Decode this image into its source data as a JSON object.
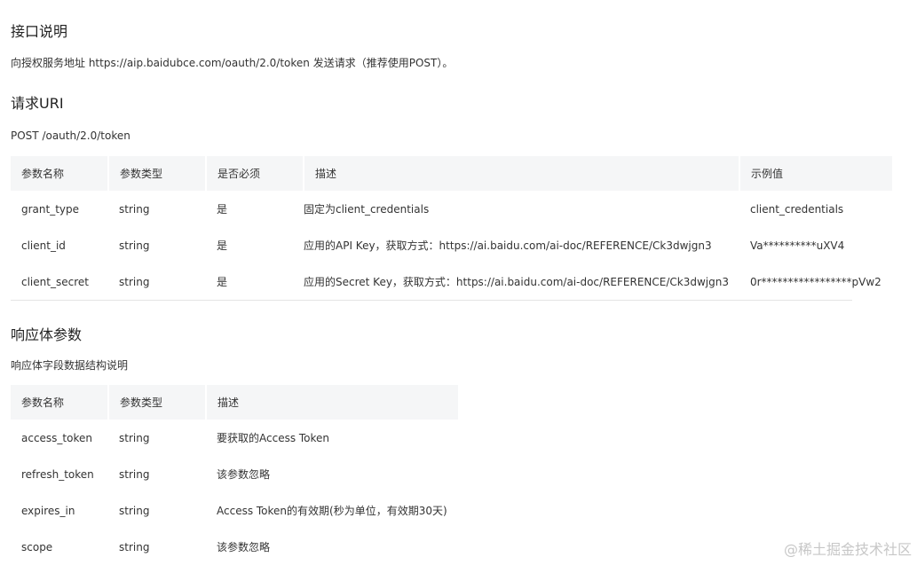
{
  "section1": {
    "title": "接口说明",
    "text": "向授权服务地址 https://aip.baidubce.com/oauth/2.0/token 发送请求（推荐使用POST）。"
  },
  "section2": {
    "title": "请求URI",
    "text": "POST /oauth/2.0/token",
    "headers": [
      "参数名称",
      "参数类型",
      "是否必须",
      "描述",
      "示例值"
    ],
    "rows": [
      [
        "grant_type",
        "string",
        "是",
        "固定为client_credentials",
        "client_credentials"
      ],
      [
        "client_id",
        "string",
        "是",
        "应用的API Key，获取方式：https://ai.baidu.com/ai-doc/REFERENCE/Ck3dwjgn3",
        "Va**********uXV4"
      ],
      [
        "client_secret",
        "string",
        "是",
        "应用的Secret Key，获取方式：https://ai.baidu.com/ai-doc/REFERENCE/Ck3dwjgn3",
        "0r*****************pVw2"
      ]
    ]
  },
  "section3": {
    "title": "响应体参数",
    "subtitle": "响应体字段数据结构说明",
    "headers": [
      "参数名称",
      "参数类型",
      "描述"
    ],
    "rows": [
      [
        "access_token",
        "string",
        "要获取的Access Token"
      ],
      [
        "refresh_token",
        "string",
        "该参数忽略"
      ],
      [
        "expires_in",
        "string",
        "Access Token的有效期(秒为单位，有效期30天)"
      ],
      [
        "scope",
        "string",
        "该参数忽略"
      ]
    ]
  },
  "watermark": "@稀土掘金技术社区"
}
